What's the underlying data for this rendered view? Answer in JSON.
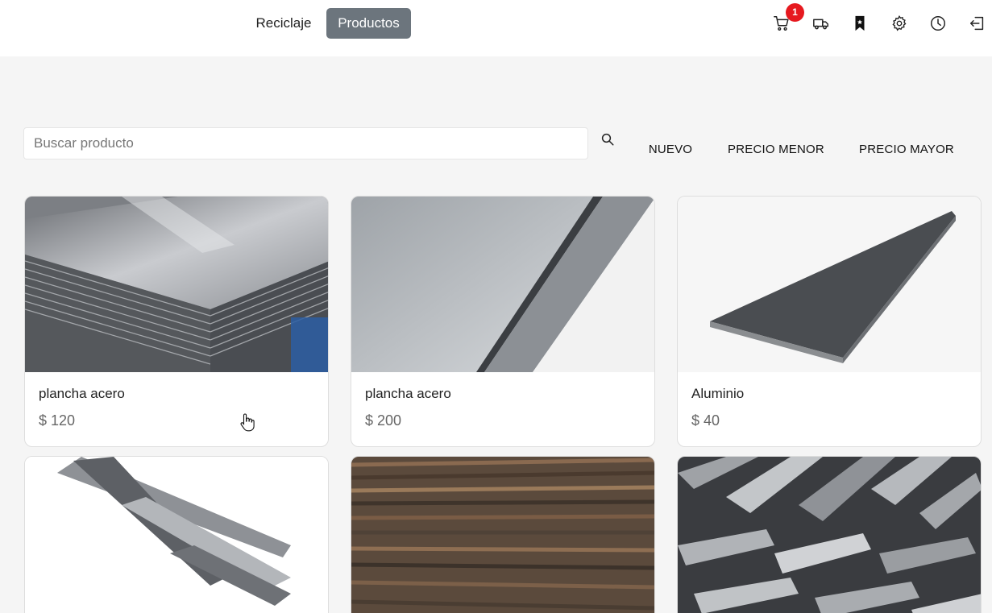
{
  "nav": {
    "links": [
      "Reciclaje",
      "Productos"
    ],
    "active": "Productos",
    "cart_count": "1",
    "icons": [
      "cart-icon",
      "truck-icon",
      "bookmark-icon",
      "gear-icon",
      "clock-icon",
      "logout-icon"
    ]
  },
  "search": {
    "placeholder": "Buscar producto",
    "value": ""
  },
  "sort": {
    "nuevo": "NUEVO",
    "menor": "PRECIO MENOR",
    "mayor": "PRECIO MAYOR"
  },
  "products": [
    {
      "title": "plancha acero",
      "price": "$ 120"
    },
    {
      "title": "plancha acero",
      "price": "$ 200"
    },
    {
      "title": "Aluminio",
      "price": "$ 40"
    }
  ],
  "colors": {
    "active_nav": "#6c757d",
    "badge": "#e6191f",
    "background": "#f5f5f5"
  }
}
